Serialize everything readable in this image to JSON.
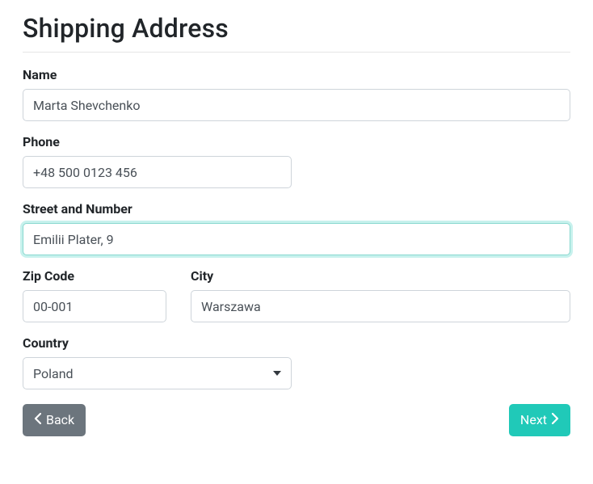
{
  "title": "Shipping Address",
  "fields": {
    "name": {
      "label": "Name",
      "value": "Marta Shevchenko"
    },
    "phone": {
      "label": "Phone",
      "value": "+48 500 0123 456"
    },
    "street": {
      "label": "Street and Number",
      "value": "Emilii Plater, 9"
    },
    "zip": {
      "label": "Zip Code",
      "value": "00-001"
    },
    "city": {
      "label": "City",
      "value": "Warszawa"
    },
    "country": {
      "label": "Country",
      "value": "Poland"
    }
  },
  "buttons": {
    "back": "Back",
    "next": "Next"
  }
}
